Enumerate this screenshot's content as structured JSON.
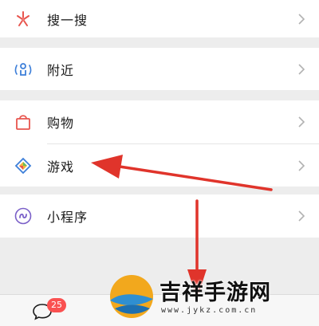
{
  "menu": {
    "search": {
      "label": "搜一搜",
      "icon": "search-sparkle-icon"
    },
    "nearby": {
      "label": "附近",
      "icon": "nearby-person-icon"
    },
    "shopping": {
      "label": "购物",
      "icon": "shopping-bag-icon"
    },
    "games": {
      "label": "游戏",
      "icon": "game-diamond-icon"
    },
    "miniprogram": {
      "label": "小程序",
      "icon": "mini-program-icon"
    }
  },
  "tabbar": {
    "chats_badge": "25",
    "chats_icon": "chat-bubble-icon"
  },
  "watermark": {
    "text": "吉祥手游网",
    "url": "www.jykz.com.cn"
  },
  "colors": {
    "background": "#ededed",
    "arrow": "#e0342b",
    "badge": "#fa5151"
  }
}
